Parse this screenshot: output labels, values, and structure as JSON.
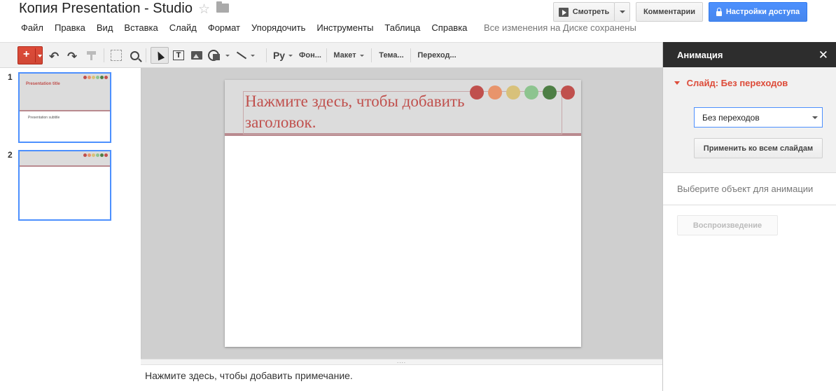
{
  "header": {
    "doc_title": "Копия Presentation - Studio",
    "star_glyph": "☆",
    "save_status": "Все изменения на Диске сохранены"
  },
  "menu": [
    "Файл",
    "Правка",
    "Вид",
    "Вставка",
    "Слайд",
    "Формат",
    "Упорядочить",
    "Инструменты",
    "Таблица",
    "Справка"
  ],
  "actions": {
    "present_label": "Смотреть",
    "comments_label": "Комментарии",
    "share_label": "Настройки доступа"
  },
  "toolbar": {
    "new_glyph": "+",
    "undo_glyph": "↶",
    "redo_glyph": "↷",
    "textbox_glyph": "T",
    "lang_label": "Ру",
    "background_label": "Фон...",
    "layout_label": "Макет",
    "theme_label": "Тема...",
    "transition_label": "Переход..."
  },
  "thumbnails": [
    {
      "number": "1",
      "title": "Presentation title",
      "subtitle": "Presentation subtitle"
    },
    {
      "number": "2",
      "title": "",
      "subtitle": ""
    }
  ],
  "slide": {
    "title_placeholder": "Нажмите здесь, чтобы добавить заголовок.",
    "dot_colors": [
      "#c0504d",
      "#e8946b",
      "#d8c17a",
      "#8dc48f",
      "#4e7f45",
      "#c0504d"
    ]
  },
  "notes": {
    "resize_glyph": "....",
    "placeholder": "Нажмите здесь, чтобы добавить примечание."
  },
  "animation_panel": {
    "title": "Анимация",
    "close_glyph": "✕",
    "slide_transition_label": "Слайд: Без переходов",
    "transition_value": "Без переходов",
    "apply_all_label": "Применить ко всем слайдам",
    "select_object_hint": "Выберите объект для анимации",
    "play_label": "Воспроизведение"
  },
  "colors": {
    "accent_blue": "#4d90fe",
    "new_red": "#dd4b39",
    "title_red": "#c0504d",
    "panel_dark": "#2d2d2d"
  }
}
